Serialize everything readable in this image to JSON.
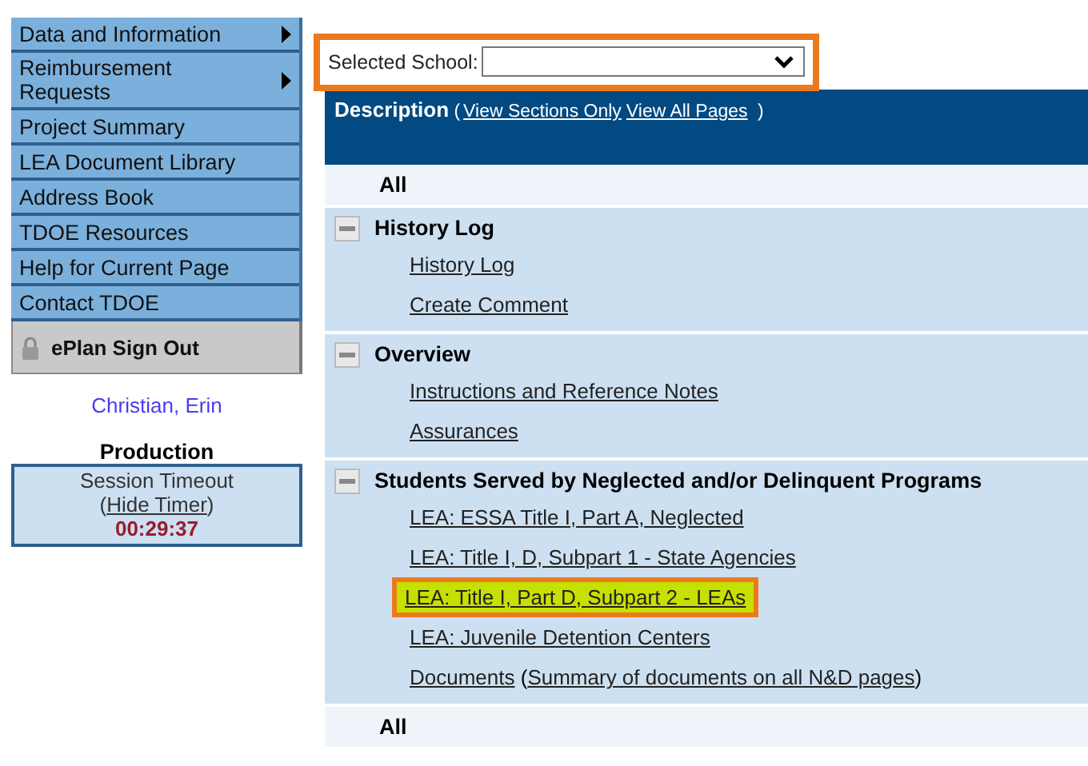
{
  "sidebar": {
    "items": [
      {
        "label": "Data and Information",
        "submenu": true
      },
      {
        "label": "Reimbursement Requests",
        "submenu": true
      },
      {
        "label": "Project Summary",
        "submenu": false
      },
      {
        "label": "LEA Document Library",
        "submenu": false
      },
      {
        "label": "Address Book",
        "submenu": false
      },
      {
        "label": "TDOE Resources",
        "submenu": false
      },
      {
        "label": "Help for Current Page",
        "submenu": false
      },
      {
        "label": "Contact TDOE",
        "submenu": false
      }
    ],
    "sign_out": "ePlan Sign Out",
    "user": "Christian, Erin",
    "environment": "Production",
    "session": {
      "title": "Session Timeout",
      "timer_link": [
        {
          "text": "(",
          "link": false
        },
        {
          "text": "Hide Timer",
          "link": true
        },
        {
          "text": ")",
          "link": false
        }
      ],
      "time": "00:29:37"
    }
  },
  "school_selector": {
    "label": "Selected School:",
    "highlighted": true
  },
  "description_header": [
    {
      "text": "Description",
      "kind": "title"
    },
    {
      "text": " (",
      "kind": "plain"
    },
    {
      "text": "View Sections Only",
      "kind": "link"
    },
    {
      "text": "View All Pages",
      "kind": "link"
    },
    {
      "text": " )",
      "kind": "plain"
    }
  ],
  "top_all": "All",
  "sections": [
    {
      "title": "History Log",
      "expanded": true,
      "pages": [
        {
          "parts": [
            {
              "text": "History Log",
              "link": true
            }
          ],
          "highlighted": false
        },
        {
          "parts": [
            {
              "text": "Create Comment",
              "link": true
            }
          ],
          "highlighted": false
        }
      ]
    },
    {
      "title": "Overview",
      "expanded": true,
      "pages": [
        {
          "parts": [
            {
              "text": "Instructions and Reference Notes",
              "link": true
            }
          ],
          "highlighted": false
        },
        {
          "parts": [
            {
              "text": "Assurances",
              "link": true
            }
          ],
          "highlighted": false
        }
      ]
    },
    {
      "title": "Students Served by Neglected and/or Delinquent Programs",
      "expanded": true,
      "pages": [
        {
          "parts": [
            {
              "text": "LEA: ESSA Title I, Part A, Neglected",
              "link": true
            }
          ],
          "highlighted": false
        },
        {
          "parts": [
            {
              "text": "LEA: Title I, D, Subpart 1 - State Agencies",
              "link": true
            }
          ],
          "highlighted": false
        },
        {
          "parts": [
            {
              "text": "LEA: Title I, Part D, Subpart 2 - LEAs",
              "link": true
            }
          ],
          "highlighted": true
        },
        {
          "parts": [
            {
              "text": "LEA: Juvenile Detention Centers",
              "link": true
            }
          ],
          "highlighted": false
        },
        {
          "parts": [
            {
              "text": "Documents",
              "link": true
            },
            {
              "text": " (",
              "link": false
            },
            {
              "text": "Summary of documents on all N&D pages",
              "link": true
            },
            {
              "text": ")",
              "link": false
            }
          ],
          "highlighted": false
        }
      ]
    }
  ],
  "bottom_all": "All"
}
